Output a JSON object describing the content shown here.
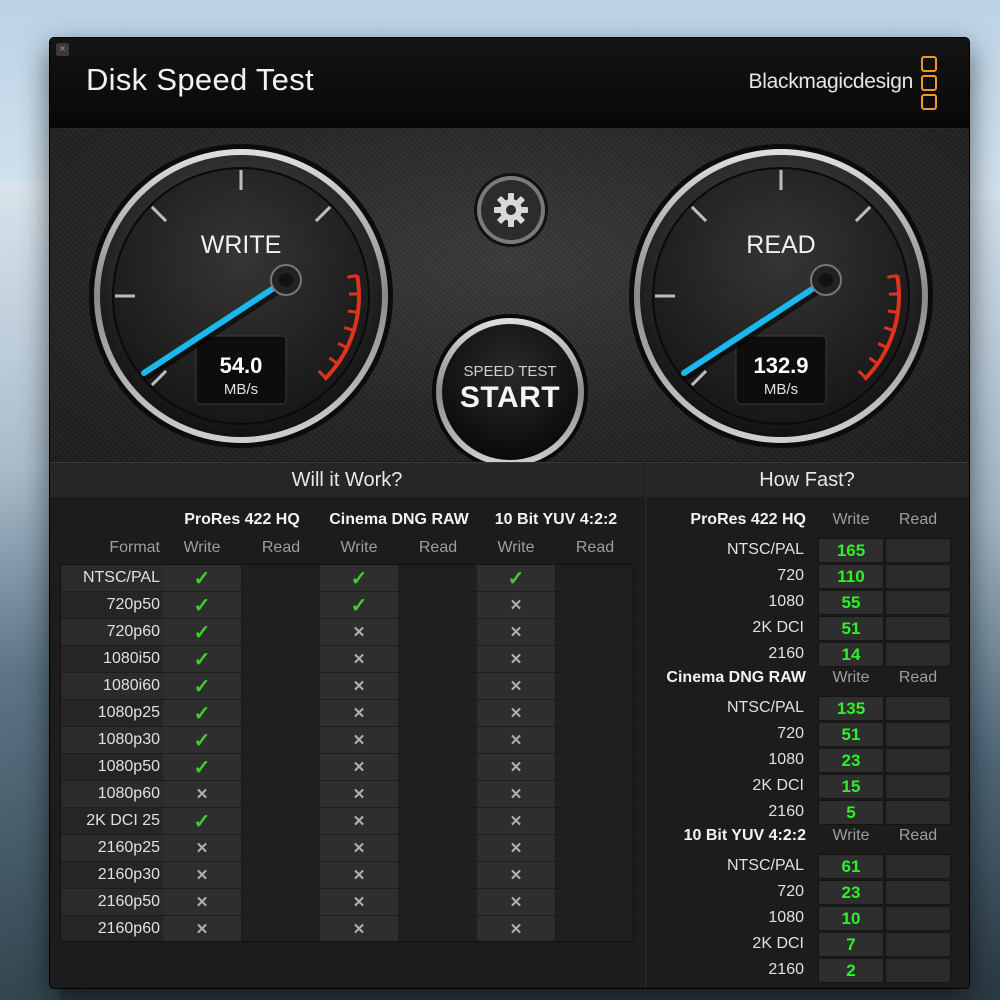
{
  "window": {
    "close_label": "×",
    "title": "Disk Speed Test",
    "brand": "Blackmagicdesign"
  },
  "colors": {
    "accent_needle": "#19b8ef",
    "check": "#3fcf2a",
    "fast_number": "#2ff02a",
    "brand_logo": "#f39a1e",
    "redline": "#e0321e"
  },
  "write_gauge": {
    "label": "WRITE",
    "value": "54.0",
    "unit": "MB/s"
  },
  "read_gauge": {
    "label": "READ",
    "value": "132.9",
    "unit": "MB/s"
  },
  "start_button": {
    "line1": "SPEED TEST",
    "line2": "START"
  },
  "settings_icon": "gear-icon",
  "will_it_work": {
    "title": "Will it Work?",
    "format_header": "Format",
    "codecs": [
      "ProRes 422 HQ",
      "Cinema DNG RAW",
      "10 Bit YUV 4:2:2"
    ],
    "sub_headers": [
      "Write",
      "Read"
    ],
    "rows": [
      {
        "format": "NTSC/PAL",
        "results": [
          "check",
          "",
          "check",
          "",
          "check",
          ""
        ]
      },
      {
        "format": "720p50",
        "results": [
          "check",
          "",
          "check",
          "",
          "cross",
          ""
        ]
      },
      {
        "format": "720p60",
        "results": [
          "check",
          "",
          "cross",
          "",
          "cross",
          ""
        ]
      },
      {
        "format": "1080i50",
        "results": [
          "check",
          "",
          "cross",
          "",
          "cross",
          ""
        ]
      },
      {
        "format": "1080i60",
        "results": [
          "check",
          "",
          "cross",
          "",
          "cross",
          ""
        ]
      },
      {
        "format": "1080p25",
        "results": [
          "check",
          "",
          "cross",
          "",
          "cross",
          ""
        ]
      },
      {
        "format": "1080p30",
        "results": [
          "check",
          "",
          "cross",
          "",
          "cross",
          ""
        ]
      },
      {
        "format": "1080p50",
        "results": [
          "check",
          "",
          "cross",
          "",
          "cross",
          ""
        ]
      },
      {
        "format": "1080p60",
        "results": [
          "cross",
          "",
          "cross",
          "",
          "cross",
          ""
        ]
      },
      {
        "format": "2K DCI 25",
        "results": [
          "check",
          "",
          "cross",
          "",
          "cross",
          ""
        ]
      },
      {
        "format": "2160p25",
        "results": [
          "cross",
          "",
          "cross",
          "",
          "cross",
          ""
        ]
      },
      {
        "format": "2160p30",
        "results": [
          "cross",
          "",
          "cross",
          "",
          "cross",
          ""
        ]
      },
      {
        "format": "2160p50",
        "results": [
          "cross",
          "",
          "cross",
          "",
          "cross",
          ""
        ]
      },
      {
        "format": "2160p60",
        "results": [
          "cross",
          "",
          "cross",
          "",
          "cross",
          ""
        ]
      }
    ]
  },
  "how_fast": {
    "title": "How Fast?",
    "groups": [
      {
        "codec": "ProRes 422 HQ",
        "write_header": "Write",
        "read_header": "Read",
        "rows": [
          {
            "format": "NTSC/PAL",
            "write": "165",
            "read": ""
          },
          {
            "format": "720",
            "write": "110",
            "read": ""
          },
          {
            "format": "1080",
            "write": "55",
            "read": ""
          },
          {
            "format": "2K DCI",
            "write": "51",
            "read": ""
          },
          {
            "format": "2160",
            "write": "14",
            "read": ""
          }
        ]
      },
      {
        "codec": "Cinema DNG RAW",
        "write_header": "Write",
        "read_header": "Read",
        "rows": [
          {
            "format": "NTSC/PAL",
            "write": "135",
            "read": ""
          },
          {
            "format": "720",
            "write": "51",
            "read": ""
          },
          {
            "format": "1080",
            "write": "23",
            "read": ""
          },
          {
            "format": "2K DCI",
            "write": "15",
            "read": ""
          },
          {
            "format": "2160",
            "write": "5",
            "read": ""
          }
        ]
      },
      {
        "codec": "10 Bit YUV 4:2:2",
        "write_header": "Write",
        "read_header": "Read",
        "rows": [
          {
            "format": "NTSC/PAL",
            "write": "61",
            "read": ""
          },
          {
            "format": "720",
            "write": "23",
            "read": ""
          },
          {
            "format": "1080",
            "write": "10",
            "read": ""
          },
          {
            "format": "2K DCI",
            "write": "7",
            "read": ""
          },
          {
            "format": "2160",
            "write": "2",
            "read": ""
          }
        ]
      }
    ]
  }
}
